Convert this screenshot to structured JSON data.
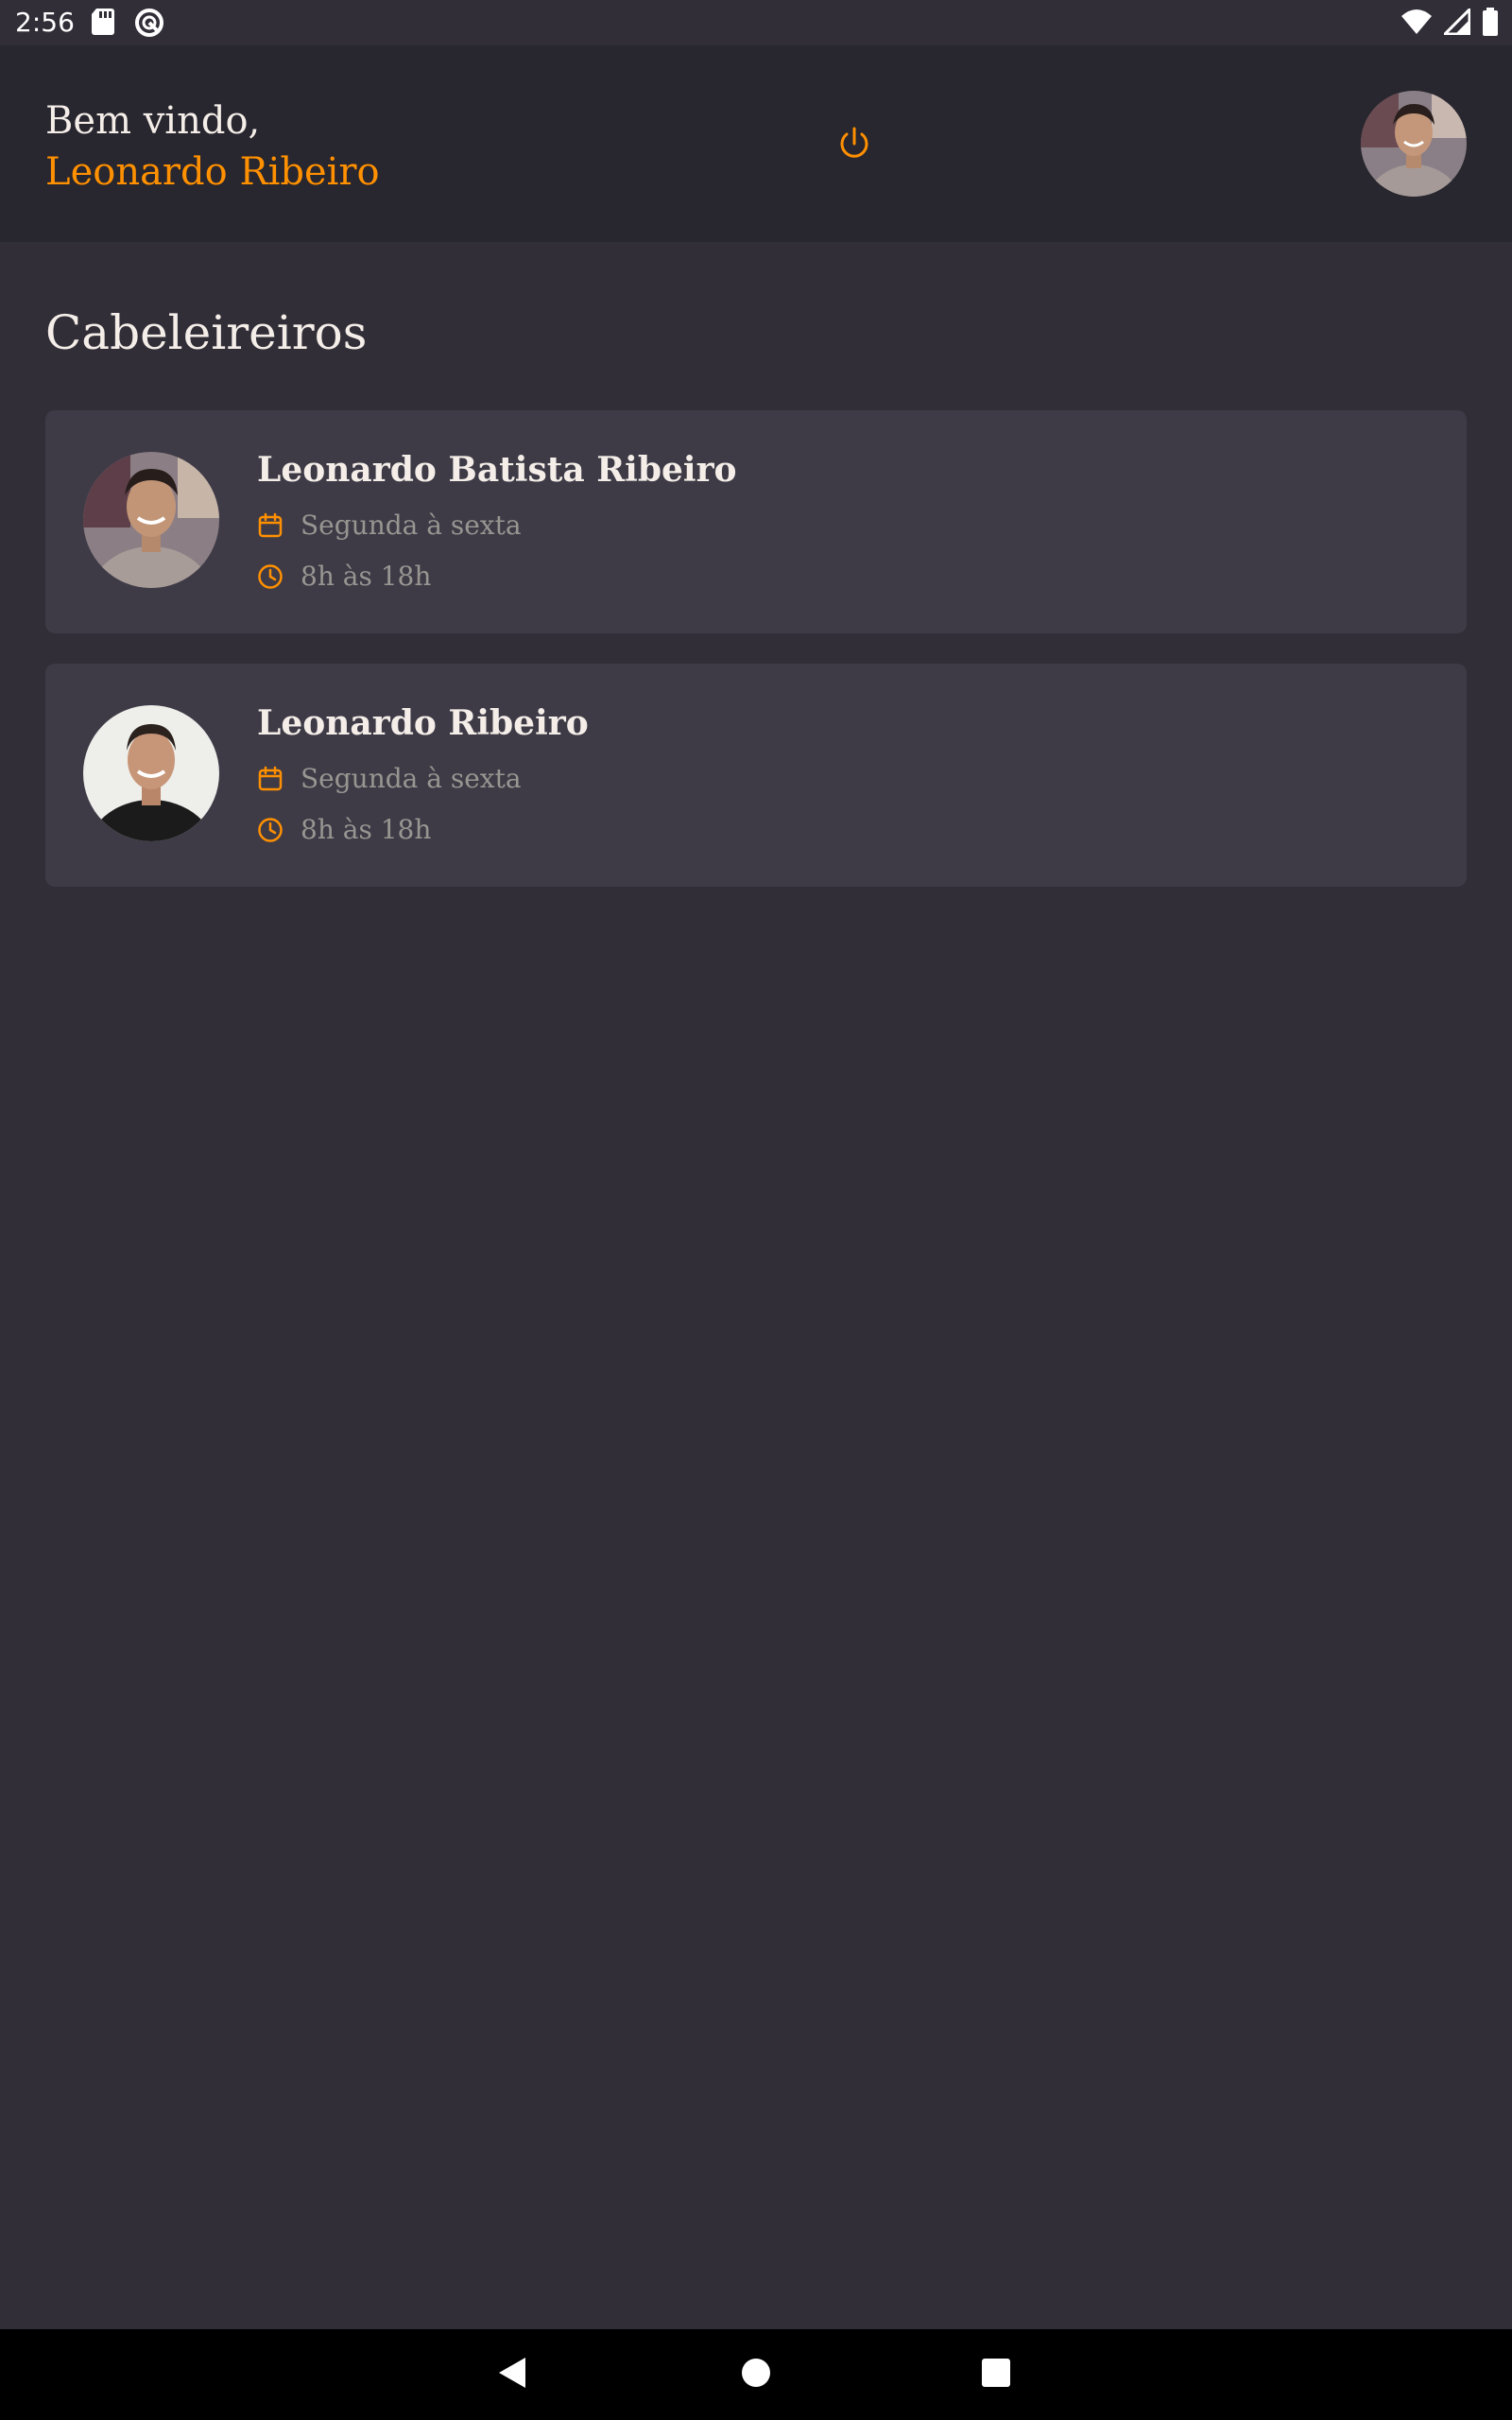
{
  "status_bar": {
    "time": "2:56",
    "left_icons": [
      "sd-card-icon",
      "sync-icon"
    ],
    "right_icons": [
      "wifi-icon",
      "cellular-signal-icon",
      "battery-icon"
    ]
  },
  "header": {
    "welcome_text": "Bem vindo,",
    "user_name": "Leonardo Ribeiro",
    "logout_icon": "power-icon",
    "avatar_icon": "user-avatar"
  },
  "main": {
    "section_title": "Cabeleireiros",
    "providers": [
      {
        "name": "Leonardo Batista Ribeiro",
        "days": "Segunda à sexta",
        "hours": "8h às 18h",
        "days_icon": "calendar-icon",
        "hours_icon": "clock-icon"
      },
      {
        "name": "Leonardo Ribeiro",
        "days": "Segunda à sexta",
        "hours": "8h às 18h",
        "days_icon": "calendar-icon",
        "hours_icon": "clock-icon"
      }
    ]
  },
  "nav_bar": {
    "buttons": [
      "back-icon",
      "home-icon",
      "recents-icon"
    ]
  },
  "colors": {
    "background": "#312e38",
    "header_background": "#28262e",
    "card_background": "#3e3b47",
    "accent": "#ff9000",
    "text_primary": "#f4ede8",
    "text_secondary": "#999591"
  }
}
